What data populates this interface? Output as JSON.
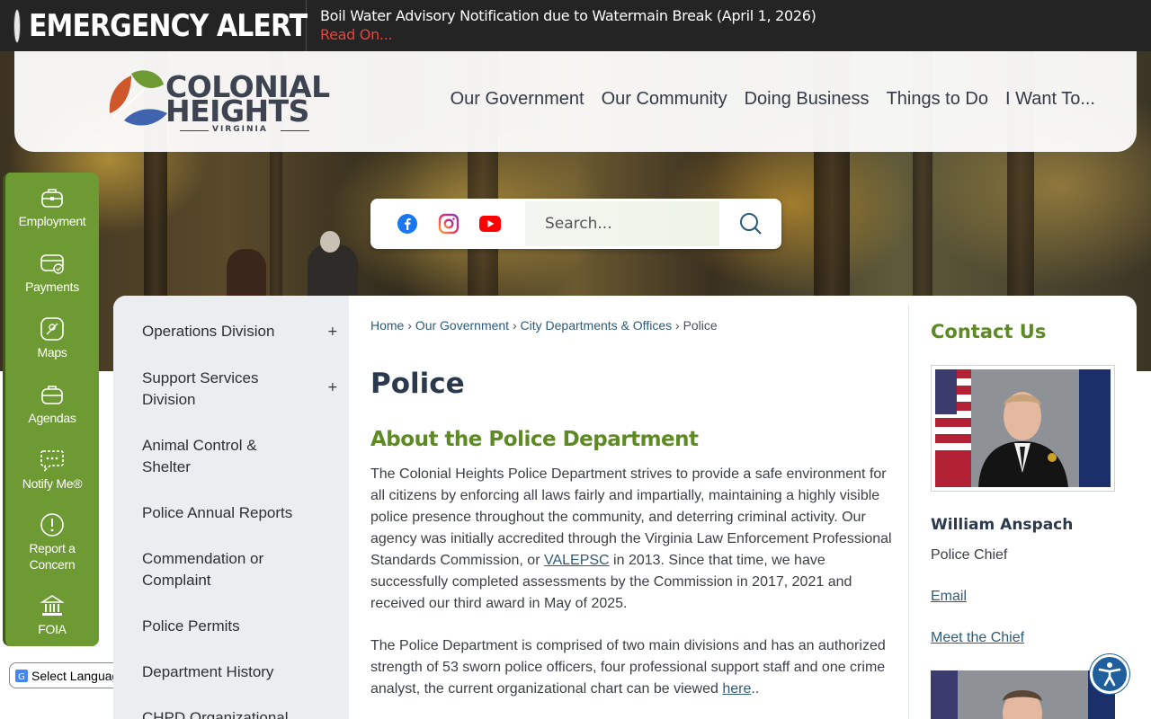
{
  "alert": {
    "title": "EMERGENCY ALERT",
    "message": "Boil Water Advisory Notification due to Watermain Break (April 1, 2026)",
    "link": "Read On..."
  },
  "logo": {
    "line1": "COLONIAL",
    "line2": "HEIGHTS",
    "line3": "VIRGINIA"
  },
  "nav": [
    "Our Government",
    "Our Community",
    "Doing Business",
    "Things to Do",
    "I Want To..."
  ],
  "social": {
    "icons": [
      "facebook-icon",
      "instagram-icon",
      "youtube-icon"
    ],
    "search_placeholder": "Search..."
  },
  "quick_links": [
    "Employment",
    "Payments",
    "Maps",
    "Agendas",
    "Notify Me®",
    "Report a Concern",
    "FOIA"
  ],
  "language": {
    "label": "Select Language"
  },
  "side_nav": [
    {
      "label": "Operations Division",
      "expandable": true
    },
    {
      "label": "Support Services Division",
      "expandable": true
    },
    {
      "label": "Animal Control & Shelter",
      "expandable": false
    },
    {
      "label": "Police Annual Reports",
      "expandable": false
    },
    {
      "label": "Commendation or Complaint",
      "expandable": false
    },
    {
      "label": "Police Permits",
      "expandable": false
    },
    {
      "label": "Department History",
      "expandable": false
    },
    {
      "label": "CHPD Organizational",
      "expandable": false
    }
  ],
  "breadcrumb": {
    "items": [
      "Home",
      "Our Government",
      "City Departments & Offices"
    ],
    "current": "Police",
    "separator": "›"
  },
  "page": {
    "title": "Police",
    "section_title": "About the Police Department",
    "para1_a": "The Colonial Heights Police Department strives to provide a safe environment for all citizens by enforcing all laws fairly and impartially, maintaining a highly visible police presence throughout the community, and deterring criminal activity. Our agency was initially accredited through the Virginia Law Enforcement Professional Standards Commission, or ",
    "para1_link": "VALEPSC",
    "para1_b": " in 2013. Since that time, we have successfully completed assessments by the Commission in 2017, 2021 and received our third award in May of 2025.",
    "para2_a": " The Police Department is comprised of two main divisions and has an authorized strength of 53 sworn police officers, four professional support staff and one crime analyst, the current organizational chart can be viewed ",
    "para2_link": "here",
    "para2_b": ".."
  },
  "contact": {
    "title": "Contact Us",
    "name": "William Anspach",
    "role": "Police Chief",
    "email_link": "Email",
    "meet_link": "Meet the Chief"
  },
  "colors": {
    "alert_bar": "#242424",
    "alert_red": "#e8443b",
    "brand_green": "#6e9a33",
    "heading_green": "#5e8a23",
    "link_blue": "#2e5b7a",
    "title_navy": "#2a3a4c"
  }
}
